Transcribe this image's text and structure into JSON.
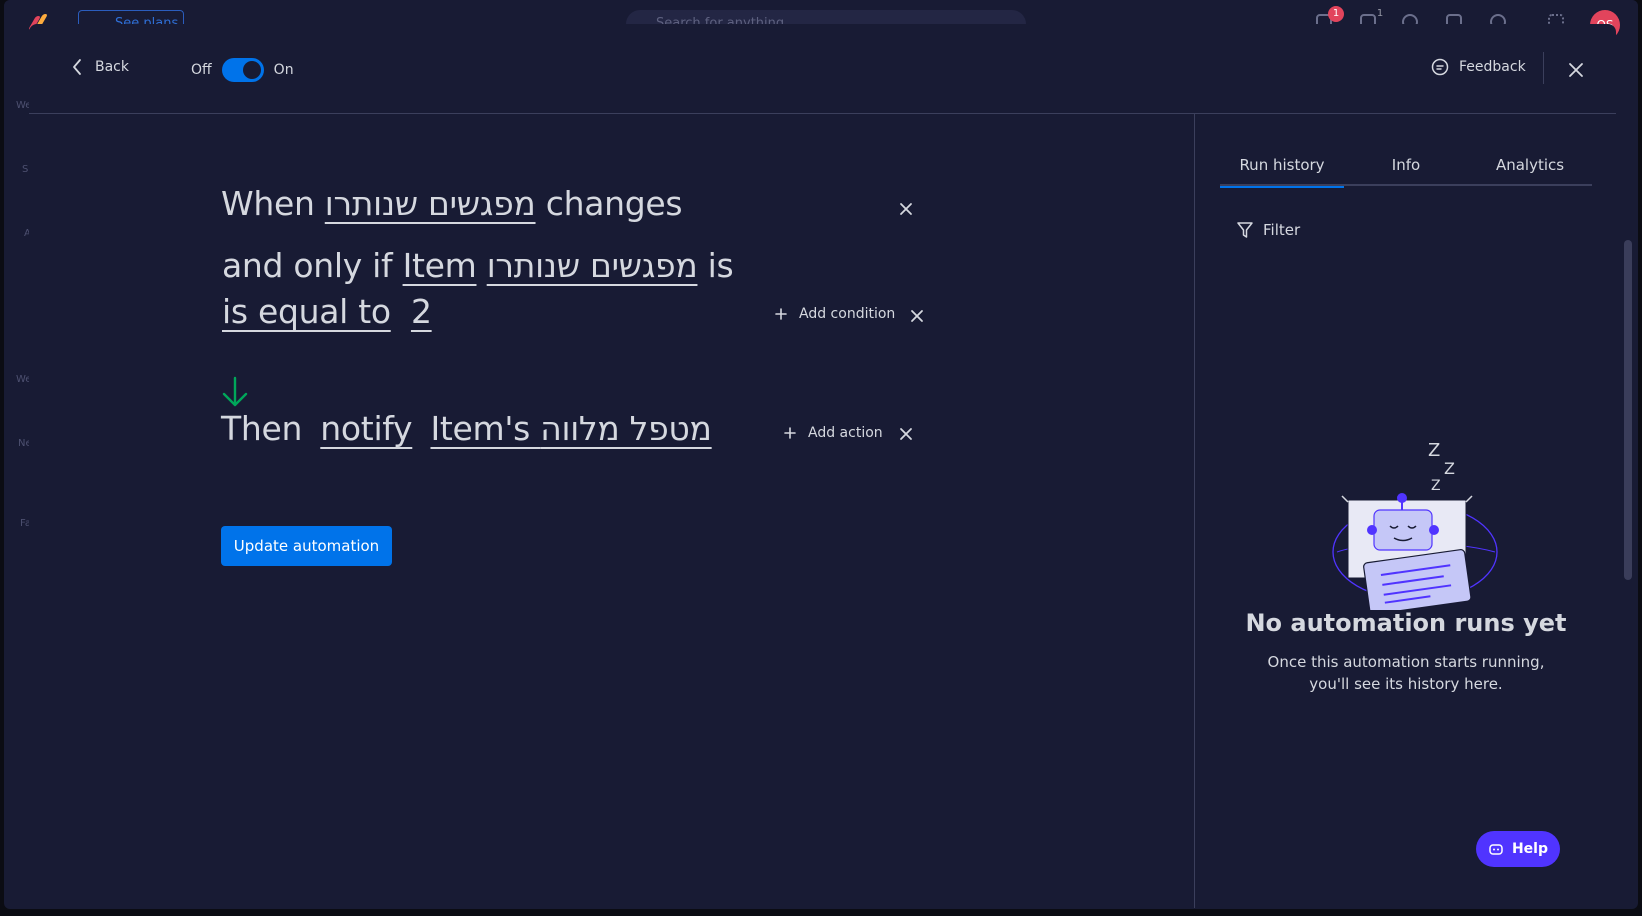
{
  "background": {
    "see_plans": "See plans",
    "search_placeholder": "Search for anything...",
    "badges": [
      "1",
      "1"
    ],
    "avatar_initials": "OS",
    "side_labels": [
      "We",
      "S",
      "A",
      "We",
      "Ne",
      "Fa"
    ]
  },
  "header": {
    "back_label": "Back",
    "toggle_off": "Off",
    "toggle_on": "On",
    "toggle_state": "on",
    "feedback_label": "Feedback"
  },
  "trigger": {
    "when": "When",
    "column": "מפגשים שנותרו",
    "changes": "changes"
  },
  "condition": {
    "and_only_if": "and only if",
    "item": "Item",
    "column": "מפגשים שנותרו",
    "is": "is",
    "operator": "is equal to",
    "value": "2",
    "add_label": "Add condition"
  },
  "action": {
    "then": "Then",
    "verb": "notify",
    "target": "Item's מטפל מלווה",
    "add_label": "Add action"
  },
  "update_button": "Update automation",
  "right_panel": {
    "tabs": [
      "Run history",
      "Info",
      "Analytics"
    ],
    "active_tab": "Run history",
    "filter_label": "Filter",
    "empty_title": "No automation runs yet",
    "empty_desc_line1": "Once this automation starts running,",
    "empty_desc_line2": "you'll see its history here.",
    "zzz": [
      "Z",
      "Z",
      "Z"
    ]
  },
  "help_label": "Help",
  "colors": {
    "accent": "#0073ea",
    "arrow_green": "#00a65a",
    "help_purple": "#5034ff",
    "modal_bg": "#181b34"
  }
}
